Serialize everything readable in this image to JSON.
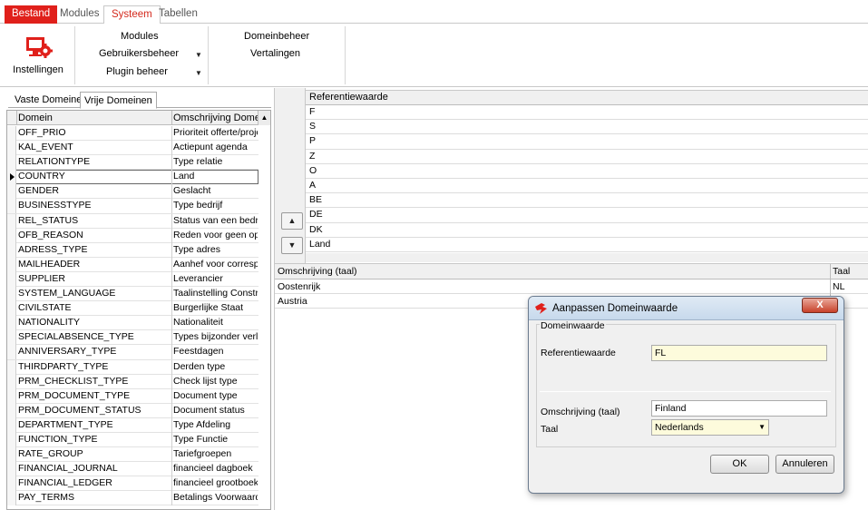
{
  "ribbon_tabs": [
    "Bestand",
    "Modules",
    "Systeem",
    "Tabellen"
  ],
  "ribbon": {
    "instellingen": "Instellingen",
    "modules": "Modules",
    "gebruikersbeheer": "Gebruikersbeheer",
    "plugin_beheer": "Plugin beheer",
    "domeinbeheer": "Domeinbeheer",
    "vertalingen": "Vertalingen"
  },
  "left_tabs": [
    "Vaste Domeinen",
    "Vrije Domeinen"
  ],
  "domain_grid": {
    "headers": [
      "Domein",
      "Omschrijving Domein"
    ],
    "selected_index": 3,
    "rows": [
      [
        "OFF_PRIO",
        "Prioriteit offerte/proje"
      ],
      [
        "KAL_EVENT",
        "Actiepunt agenda"
      ],
      [
        "RELATIONTYPE",
        "Type relatie"
      ],
      [
        "COUNTRY",
        "Land"
      ],
      [
        "GENDER",
        "Geslacht"
      ],
      [
        "BUSINESSTYPE",
        "Type bedrijf"
      ],
      [
        "REL_STATUS",
        "Status van een bedrij"
      ],
      [
        "OFB_REASON",
        "Reden voor geen opd"
      ],
      [
        "ADRESS_TYPE",
        "Type adres"
      ],
      [
        "MAILHEADER",
        "Aanhef voor correspo"
      ],
      [
        "SUPPLIER",
        "Leverancier"
      ],
      [
        "SYSTEM_LANGUAGE",
        "Taalinstelling Constru"
      ],
      [
        "CIVILSTATE",
        "Burgerlijke Staat"
      ],
      [
        "NATIONALITY",
        "Nationaliteit"
      ],
      [
        "SPECIALABSENCE_TYPE",
        "Types bijzonder verlo"
      ],
      [
        "ANNIVERSARY_TYPE",
        "Feestdagen"
      ],
      [
        "THIRDPARTY_TYPE",
        "Derden type"
      ],
      [
        "PRM_CHECKLIST_TYPE",
        "Check lijst type"
      ],
      [
        "PRM_DOCUMENT_TYPE",
        "Document type"
      ],
      [
        "PRM_DOCUMENT_STATUS",
        "Document status"
      ],
      [
        "DEPARTMENT_TYPE",
        "Type Afdeling"
      ],
      [
        "FUNCTION_TYPE",
        "Type Functie"
      ],
      [
        "RATE_GROUP",
        "Tariefgroepen"
      ],
      [
        "FINANCIAL_JOURNAL",
        "financieel dagboek"
      ],
      [
        "FINANCIAL_LEDGER",
        "financieel grootboek"
      ],
      [
        "PAY_TERMS",
        "Betalings Voorwaarde"
      ]
    ]
  },
  "ref_grid": {
    "header": "Referentiewaarde",
    "rows": [
      "F",
      "S",
      "P",
      "Z",
      "O",
      "A",
      "BE",
      "DE",
      "DK",
      "Land"
    ]
  },
  "oms_grid": {
    "headers": [
      "Omschrijving (taal)",
      "Taal"
    ],
    "rows": [
      [
        "Oostenrijk",
        "NL"
      ],
      [
        "Austria",
        ""
      ]
    ]
  },
  "dialog": {
    "title": "Aanpassen Domeinwaarde",
    "close": "X",
    "group": "Domeinwaarde",
    "ref_label": "Referentiewaarde",
    "ref_value": "FL",
    "oms_label": "Omschrijving (taal)",
    "oms_value": "Finland",
    "taal_label": "Taal",
    "taal_value": "Nederlands",
    "ok": "OK",
    "cancel": "Annuleren"
  },
  "colors": {
    "accent": "#e0201b",
    "field_yellow": "#fdfbdc"
  }
}
